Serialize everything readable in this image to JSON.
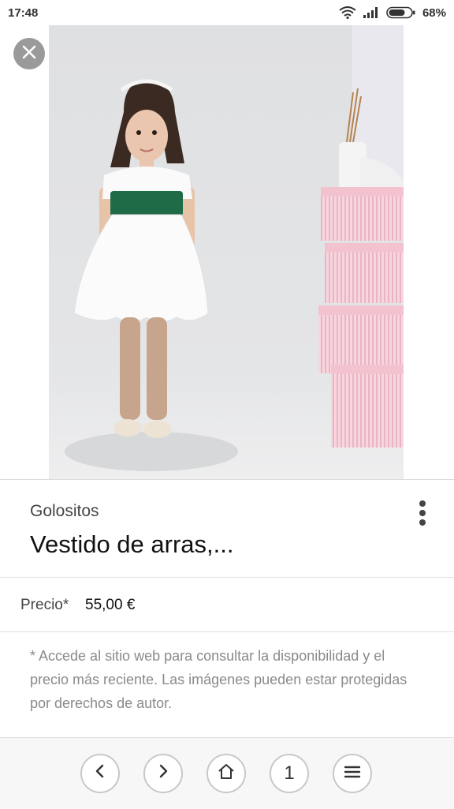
{
  "status_bar": {
    "time": "17:48",
    "battery_percent": "68%",
    "battery_level": 0.68,
    "icons": [
      "wifi-icon",
      "signal-icon",
      "battery-icon"
    ]
  },
  "image": {
    "close_icon": "close-icon"
  },
  "product": {
    "seller": "Golositos",
    "title": "Vestido de arras,...",
    "price_label": "Precio*",
    "price_value": "55,00 €",
    "disclaimer": "* Accede al sitio web para consultar la disponibilidad y el precio más reciente. Las imágenes pueden estar protegidas por derechos de autor.",
    "more_icon": "more-vertical-icon"
  },
  "nav": {
    "back_icon": "chevron-left-icon",
    "forward_icon": "chevron-right-icon",
    "home_icon": "home-icon",
    "tabs_count": "1",
    "menu_icon": "menu-icon"
  }
}
